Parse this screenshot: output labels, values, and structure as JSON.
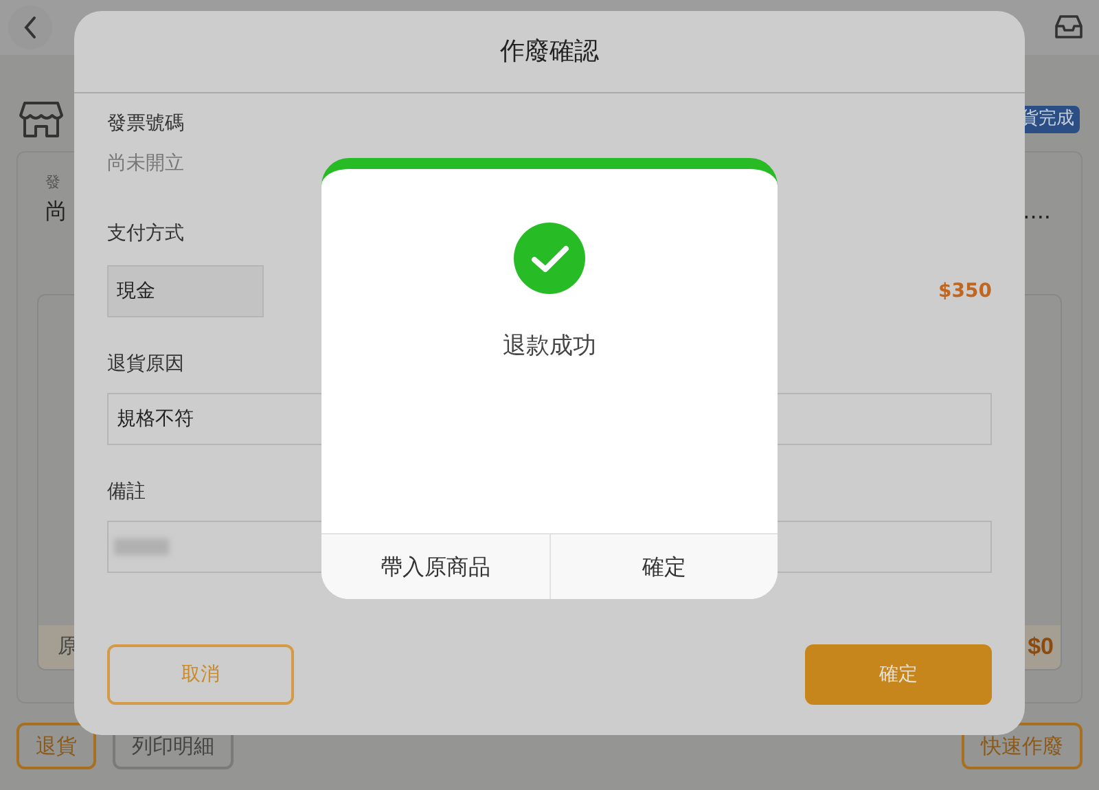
{
  "background": {
    "status_badge": "貨完成",
    "invoice_label": "發",
    "invoice_value": "尚",
    "ellipsis": "....",
    "footer_label": "原",
    "footer_amount": "$0",
    "buttons": [
      {
        "label": "退貨",
        "kind": "accent"
      },
      {
        "label": "列印明細",
        "kind": "plain"
      },
      {
        "label": "快速作廢",
        "kind": "accent"
      }
    ]
  },
  "dialog": {
    "title": "作廢確認",
    "invoice": {
      "label": "發票號碼",
      "value": "尚未開立"
    },
    "payment": {
      "label": "支付方式",
      "value": "現金",
      "amount": "$350"
    },
    "reason": {
      "label": "退貨原因",
      "value": "規格不符"
    },
    "note": {
      "label": "備註"
    },
    "buttons": [
      {
        "label": "取消",
        "kind": "outline"
      },
      {
        "label": "確定",
        "kind": "primary"
      }
    ]
  },
  "alert": {
    "message": "退款成功",
    "buttons": [
      {
        "label": "帶入原商品"
      },
      {
        "label": "確定"
      }
    ]
  }
}
